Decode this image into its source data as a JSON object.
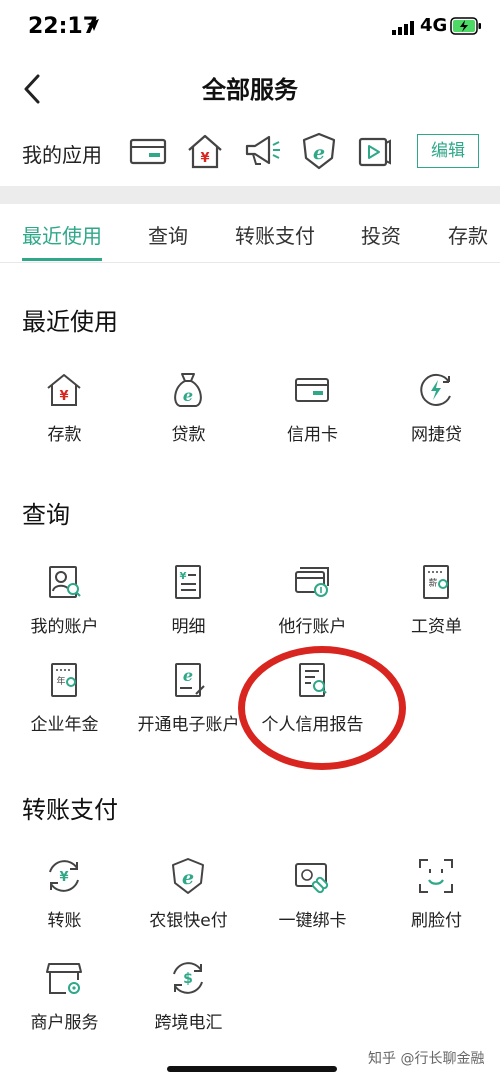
{
  "status_bar": {
    "time": "22:17",
    "network": "4G"
  },
  "nav": {
    "title": "全部服务"
  },
  "my_apps": {
    "label": "我的应用",
    "icons": [
      "card-icon",
      "house-yen-icon",
      "megaphone-icon",
      "shield-e-icon",
      "video-icon"
    ],
    "edit_label": "编辑"
  },
  "tabs": [
    {
      "label": "最近使用",
      "active": true
    },
    {
      "label": "查询",
      "active": false
    },
    {
      "label": "转账支付",
      "active": false
    },
    {
      "label": "投资",
      "active": false
    },
    {
      "label": "存款",
      "active": false
    }
  ],
  "sections": [
    {
      "title": "最近使用",
      "items": [
        {
          "label": "存款",
          "icon": "house-yen-icon"
        },
        {
          "label": "贷款",
          "icon": "money-bag-icon"
        },
        {
          "label": "信用卡",
          "icon": "card-icon"
        },
        {
          "label": "网捷贷",
          "icon": "lightning-icon"
        }
      ]
    },
    {
      "title": "查询",
      "items": [
        {
          "label": "我的账户",
          "icon": "account-search-icon"
        },
        {
          "label": "明细",
          "icon": "yen-list-icon"
        },
        {
          "label": "他行账户",
          "icon": "cards-icon"
        },
        {
          "label": "工资单",
          "icon": "salary-icon"
        },
        {
          "label": "企业年金",
          "icon": "annuity-icon"
        },
        {
          "label": "开通电子账户",
          "icon": "e-account-icon"
        },
        {
          "label": "个人信用报告",
          "icon": "credit-report-icon"
        }
      ]
    },
    {
      "title": "转账支付",
      "items": [
        {
          "label": "转账",
          "icon": "transfer-icon"
        },
        {
          "label": "农银快e付",
          "icon": "shield-e-icon"
        },
        {
          "label": "一键绑卡",
          "icon": "bind-card-icon"
        },
        {
          "label": "刷脸付",
          "icon": "face-pay-icon"
        },
        {
          "label": "商户服务",
          "icon": "shop-icon"
        },
        {
          "label": "跨境电汇",
          "icon": "remittance-icon"
        }
      ]
    }
  ],
  "watermark": "知乎 @行长聊金融",
  "colors": {
    "accent": "#2fa88a",
    "annotation": "#d8251f"
  }
}
